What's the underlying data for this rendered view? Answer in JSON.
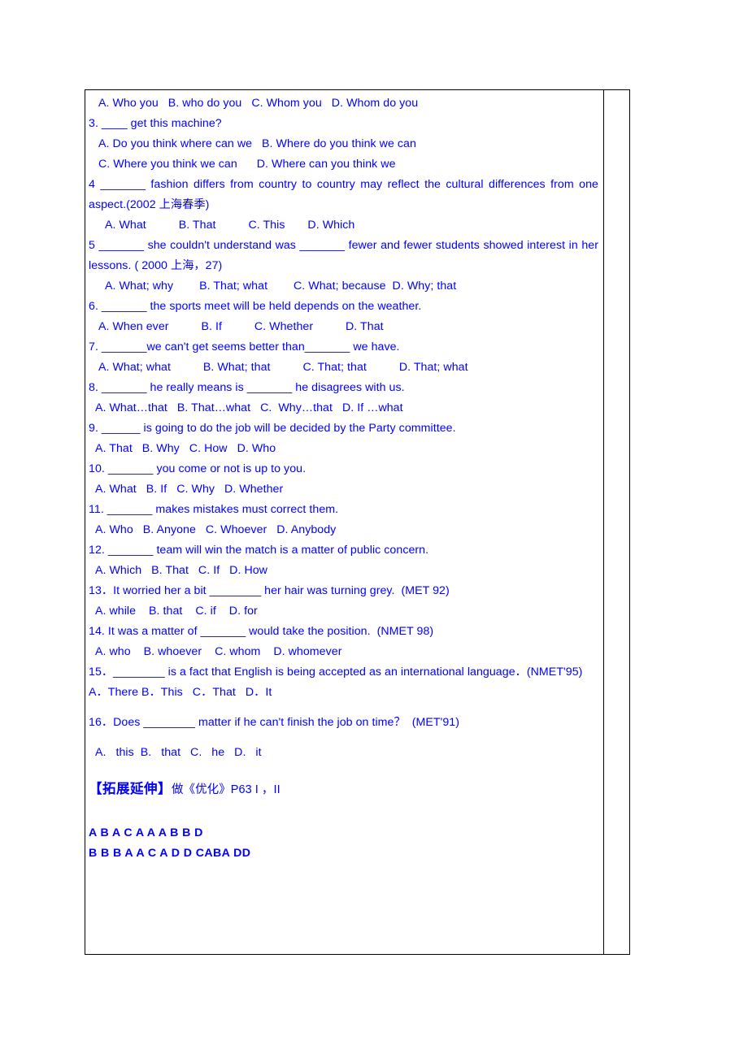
{
  "document": {
    "text_color": "#0000ff",
    "border_color": "#000000",
    "lines": {
      "q2_options": "   A. Who you   B. who do you   C. Whom you   D. Whom do you",
      "q3_stem": "3. ____ get this machine?",
      "q3_options_ab": "   A. Do you think where can we   B. Where do you think we can",
      "q3_options_cd": "   C. Where you think we can      D. Where can you think we",
      "q4_stem": "4 _______ fashion differs from country to country may reflect the cultural differences from one aspect.(2002 上海春季)",
      "q4_options": "     A. What          B. That          C. This       D. Which",
      "q5_stem": "5 _______ she couldn't understand was _______ fewer and fewer students showed interest in her lessons. ( 2000 上海，27)",
      "q5_options": "     A. What; why        B. That; what        C. What; because  D. Why; that",
      "q6_stem": "6. _______ the sports meet will be held depends on the weather.",
      "q6_options": "   A. When ever          B. If          C. Whether          D. That",
      "q7_stem": "7. _______we can't get seems better than_______ we have.",
      "q7_options": "   A. What; what          B. What; that          C. That; that          D. That; what",
      "q8_stem": "8. _______ he really means is _______ he disagrees with us.",
      "q8_options": "  A. What…that   B. That…what   C.  Why…that   D. If …what",
      "q9_stem": "9. ______ is going to do the job will be decided by the Party committee.",
      "q9_options": "  A. That   B. Why   C. How   D. Who",
      "q10_stem": "10. _______ you come or not is up to you.",
      "q10_options": "  A. What   B. If   C. Why   D. Whether",
      "q11_stem": "11. _______ makes mistakes must correct them.",
      "q11_options": "  A. Who   B. Anyone   C. Whoever   D. Anybody",
      "q12_stem": "12. _______ team will win the match is a matter of public concern.",
      "q12_options": "  A. Which   B. That   C. If   D. How",
      "q13_stem": "13．It worried her a bit ________ her hair was turning grey.  (MET 92)",
      "q13_options": "  A. while    B. that    C. if    D. for",
      "q14_stem": "14. It was a matter of _______ would take the position.  (NMET 98)",
      "q14_options": "  A. who    B. whoever    C. whom    D. whomever",
      "q15_stem": "15．________ is a fact that English is being accepted as an international language．(NMET'95)",
      "q15_options": "A．There B．This   C．That   D．It",
      "q16_stem": "16．Does ________ matter if he can't finish the job on time？  (MET'91)",
      "q16_options": "  A.   this  B.   that   C.   he   D.   it"
    },
    "extension": {
      "label": "【拓展延伸】",
      "rest": "做《优化》P63 I ，II"
    },
    "answer_key": {
      "line1": "A B A C A A A B B D",
      "line2": "B B B A A C A D D CABA DD"
    }
  }
}
